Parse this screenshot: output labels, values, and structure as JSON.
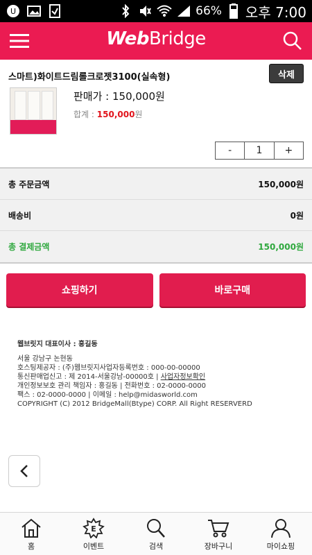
{
  "status_bar": {
    "battery": "66%",
    "time": "오후 7:00"
  },
  "header": {
    "logo_web": "Web",
    "logo_bridge": "Bridge",
    "brand_color": "#eb1b52"
  },
  "product": {
    "name": "스마트)화이트드림롤크로젯3100(실속형)",
    "delete_label": "삭제",
    "price_label": "판매가 : 150,000원",
    "total_label": "합계 : ",
    "total_value": "150,000",
    "total_unit": "원",
    "qty_minus": "-",
    "qty": "1",
    "qty_plus": "+"
  },
  "summary": {
    "rows": [
      {
        "label": "총 주문금액",
        "value": "150,000원"
      },
      {
        "label": "배송비",
        "value": "0원"
      },
      {
        "label": "총 결제금액",
        "value": "150,000원"
      }
    ]
  },
  "actions": {
    "shop": "쇼핑하기",
    "buy": "바로구매"
  },
  "footer": {
    "ceo": "웹브릿지 대표이사 : 홍길동",
    "addr": "서울 강남구 논현동",
    "host": "호스팅제공자 : (주)웹브릿지사업자등록번호 : 000-00-00000",
    "telecom_prefix": "통신판매업신고 : 제 2014-서울강남-00000호 | ",
    "telecom_link": "사업자정보확인",
    "privacy": "개인정보보호 관리 책임자 : 홍길동 | 전화번호 : 02-0000-0000",
    "fax": "팩스 : 02-0000-0000 | 이메일 : help@midasworld.com",
    "copyright": "COPYRIGHT (C) 2012 BridgeMall(Btype) CORP. All Right RESERVERD"
  },
  "bottom_nav": [
    {
      "label": "홈",
      "icon": "home-icon"
    },
    {
      "label": "이벤트",
      "icon": "event-icon"
    },
    {
      "label": "검색",
      "icon": "search-icon"
    },
    {
      "label": "장바구니",
      "icon": "cart-icon"
    },
    {
      "label": "마이쇼핑",
      "icon": "person-icon"
    }
  ]
}
